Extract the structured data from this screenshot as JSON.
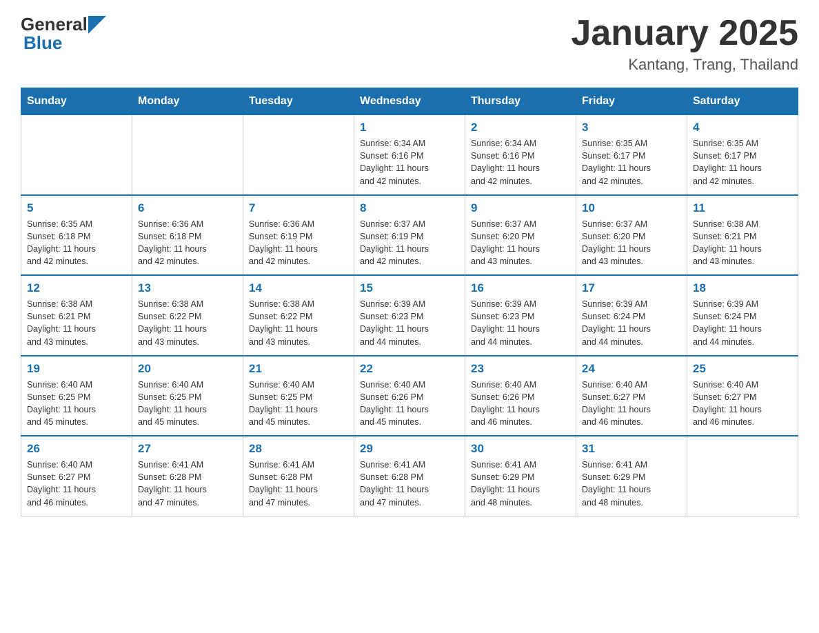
{
  "header": {
    "logo_general": "General",
    "logo_blue": "Blue",
    "month_title": "January 2025",
    "location": "Kantang, Trang, Thailand"
  },
  "weekdays": [
    "Sunday",
    "Monday",
    "Tuesday",
    "Wednesday",
    "Thursday",
    "Friday",
    "Saturday"
  ],
  "weeks": [
    [
      {
        "day": "",
        "info": ""
      },
      {
        "day": "",
        "info": ""
      },
      {
        "day": "",
        "info": ""
      },
      {
        "day": "1",
        "info": "Sunrise: 6:34 AM\nSunset: 6:16 PM\nDaylight: 11 hours\nand 42 minutes."
      },
      {
        "day": "2",
        "info": "Sunrise: 6:34 AM\nSunset: 6:16 PM\nDaylight: 11 hours\nand 42 minutes."
      },
      {
        "day": "3",
        "info": "Sunrise: 6:35 AM\nSunset: 6:17 PM\nDaylight: 11 hours\nand 42 minutes."
      },
      {
        "day": "4",
        "info": "Sunrise: 6:35 AM\nSunset: 6:17 PM\nDaylight: 11 hours\nand 42 minutes."
      }
    ],
    [
      {
        "day": "5",
        "info": "Sunrise: 6:35 AM\nSunset: 6:18 PM\nDaylight: 11 hours\nand 42 minutes."
      },
      {
        "day": "6",
        "info": "Sunrise: 6:36 AM\nSunset: 6:18 PM\nDaylight: 11 hours\nand 42 minutes."
      },
      {
        "day": "7",
        "info": "Sunrise: 6:36 AM\nSunset: 6:19 PM\nDaylight: 11 hours\nand 42 minutes."
      },
      {
        "day": "8",
        "info": "Sunrise: 6:37 AM\nSunset: 6:19 PM\nDaylight: 11 hours\nand 42 minutes."
      },
      {
        "day": "9",
        "info": "Sunrise: 6:37 AM\nSunset: 6:20 PM\nDaylight: 11 hours\nand 43 minutes."
      },
      {
        "day": "10",
        "info": "Sunrise: 6:37 AM\nSunset: 6:20 PM\nDaylight: 11 hours\nand 43 minutes."
      },
      {
        "day": "11",
        "info": "Sunrise: 6:38 AM\nSunset: 6:21 PM\nDaylight: 11 hours\nand 43 minutes."
      }
    ],
    [
      {
        "day": "12",
        "info": "Sunrise: 6:38 AM\nSunset: 6:21 PM\nDaylight: 11 hours\nand 43 minutes."
      },
      {
        "day": "13",
        "info": "Sunrise: 6:38 AM\nSunset: 6:22 PM\nDaylight: 11 hours\nand 43 minutes."
      },
      {
        "day": "14",
        "info": "Sunrise: 6:38 AM\nSunset: 6:22 PM\nDaylight: 11 hours\nand 43 minutes."
      },
      {
        "day": "15",
        "info": "Sunrise: 6:39 AM\nSunset: 6:23 PM\nDaylight: 11 hours\nand 44 minutes."
      },
      {
        "day": "16",
        "info": "Sunrise: 6:39 AM\nSunset: 6:23 PM\nDaylight: 11 hours\nand 44 minutes."
      },
      {
        "day": "17",
        "info": "Sunrise: 6:39 AM\nSunset: 6:24 PM\nDaylight: 11 hours\nand 44 minutes."
      },
      {
        "day": "18",
        "info": "Sunrise: 6:39 AM\nSunset: 6:24 PM\nDaylight: 11 hours\nand 44 minutes."
      }
    ],
    [
      {
        "day": "19",
        "info": "Sunrise: 6:40 AM\nSunset: 6:25 PM\nDaylight: 11 hours\nand 45 minutes."
      },
      {
        "day": "20",
        "info": "Sunrise: 6:40 AM\nSunset: 6:25 PM\nDaylight: 11 hours\nand 45 minutes."
      },
      {
        "day": "21",
        "info": "Sunrise: 6:40 AM\nSunset: 6:25 PM\nDaylight: 11 hours\nand 45 minutes."
      },
      {
        "day": "22",
        "info": "Sunrise: 6:40 AM\nSunset: 6:26 PM\nDaylight: 11 hours\nand 45 minutes."
      },
      {
        "day": "23",
        "info": "Sunrise: 6:40 AM\nSunset: 6:26 PM\nDaylight: 11 hours\nand 46 minutes."
      },
      {
        "day": "24",
        "info": "Sunrise: 6:40 AM\nSunset: 6:27 PM\nDaylight: 11 hours\nand 46 minutes."
      },
      {
        "day": "25",
        "info": "Sunrise: 6:40 AM\nSunset: 6:27 PM\nDaylight: 11 hours\nand 46 minutes."
      }
    ],
    [
      {
        "day": "26",
        "info": "Sunrise: 6:40 AM\nSunset: 6:27 PM\nDaylight: 11 hours\nand 46 minutes."
      },
      {
        "day": "27",
        "info": "Sunrise: 6:41 AM\nSunset: 6:28 PM\nDaylight: 11 hours\nand 47 minutes."
      },
      {
        "day": "28",
        "info": "Sunrise: 6:41 AM\nSunset: 6:28 PM\nDaylight: 11 hours\nand 47 minutes."
      },
      {
        "day": "29",
        "info": "Sunrise: 6:41 AM\nSunset: 6:28 PM\nDaylight: 11 hours\nand 47 minutes."
      },
      {
        "day": "30",
        "info": "Sunrise: 6:41 AM\nSunset: 6:29 PM\nDaylight: 11 hours\nand 48 minutes."
      },
      {
        "day": "31",
        "info": "Sunrise: 6:41 AM\nSunset: 6:29 PM\nDaylight: 11 hours\nand 48 minutes."
      },
      {
        "day": "",
        "info": ""
      }
    ]
  ]
}
